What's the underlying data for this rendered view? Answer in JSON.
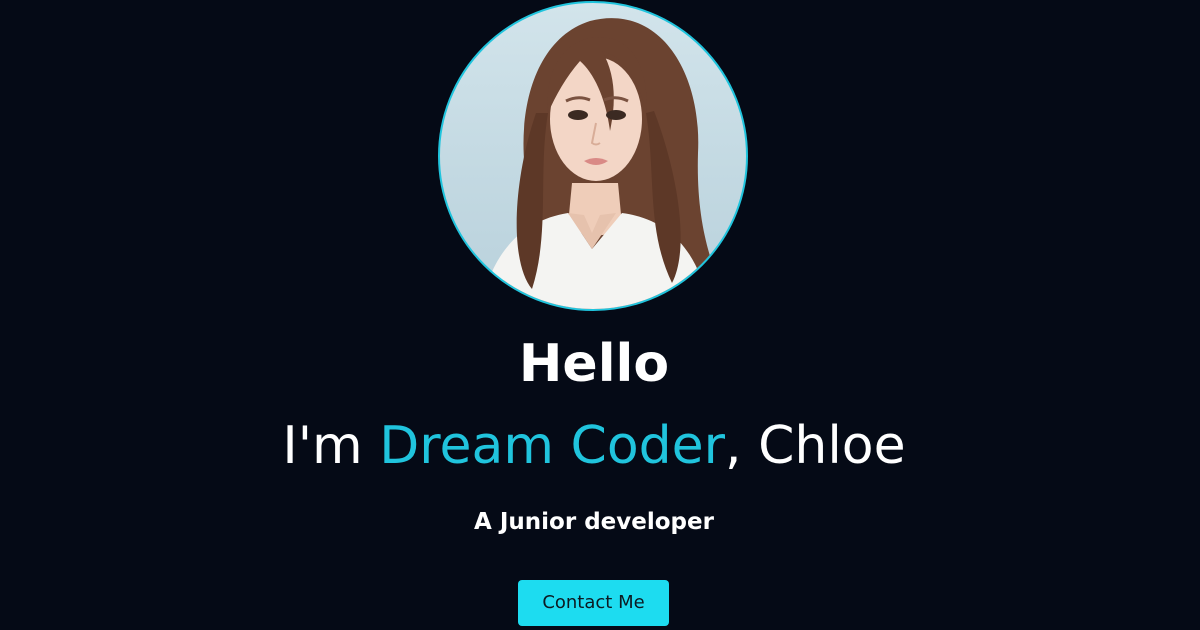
{
  "hero": {
    "avatar_alt": "Chloe profile photo",
    "greeting": "Hello",
    "intro_prefix": "I'm ",
    "intro_highlight": "Dream Coder",
    "intro_suffix": ", Chloe",
    "subtitle": "A Junior developer",
    "contact_label": "Contact Me"
  },
  "colors": {
    "background": "#050a16",
    "accent": "#20c4dd",
    "button": "#1ddcf0",
    "text": "#ffffff"
  }
}
